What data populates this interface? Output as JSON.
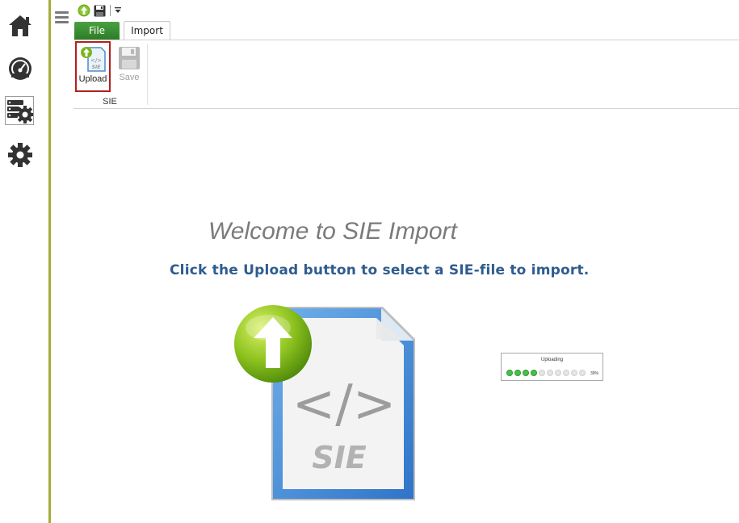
{
  "nav": {
    "items": [
      {
        "icon": "home-icon"
      },
      {
        "icon": "dashboard-icon"
      },
      {
        "icon": "server-settings-icon",
        "active": true
      },
      {
        "icon": "gear-icon"
      }
    ]
  },
  "qat": {
    "upload_icon": "upload-icon",
    "save_icon": "save-icon",
    "dropdown_icon": "chevron-down-icon"
  },
  "tabs": {
    "file": "File",
    "import": "Import"
  },
  "ribbon": {
    "upload_label": "Upload",
    "save_label": "Save",
    "group_label": "SIE"
  },
  "main": {
    "welcome": "Welcome to SIE Import",
    "instruction": "Click the Upload button to select a SIE-file to import.",
    "big_icon_text": "SIE"
  },
  "upload_preview": {
    "title": "Uploading",
    "percent": "39%",
    "progress_fraction": 0.39
  },
  "colors": {
    "accent": "#a3ad3c",
    "file_tab": "#2d7d27",
    "instruction": "#2f5c8f",
    "highlight": "#b41f1f"
  }
}
